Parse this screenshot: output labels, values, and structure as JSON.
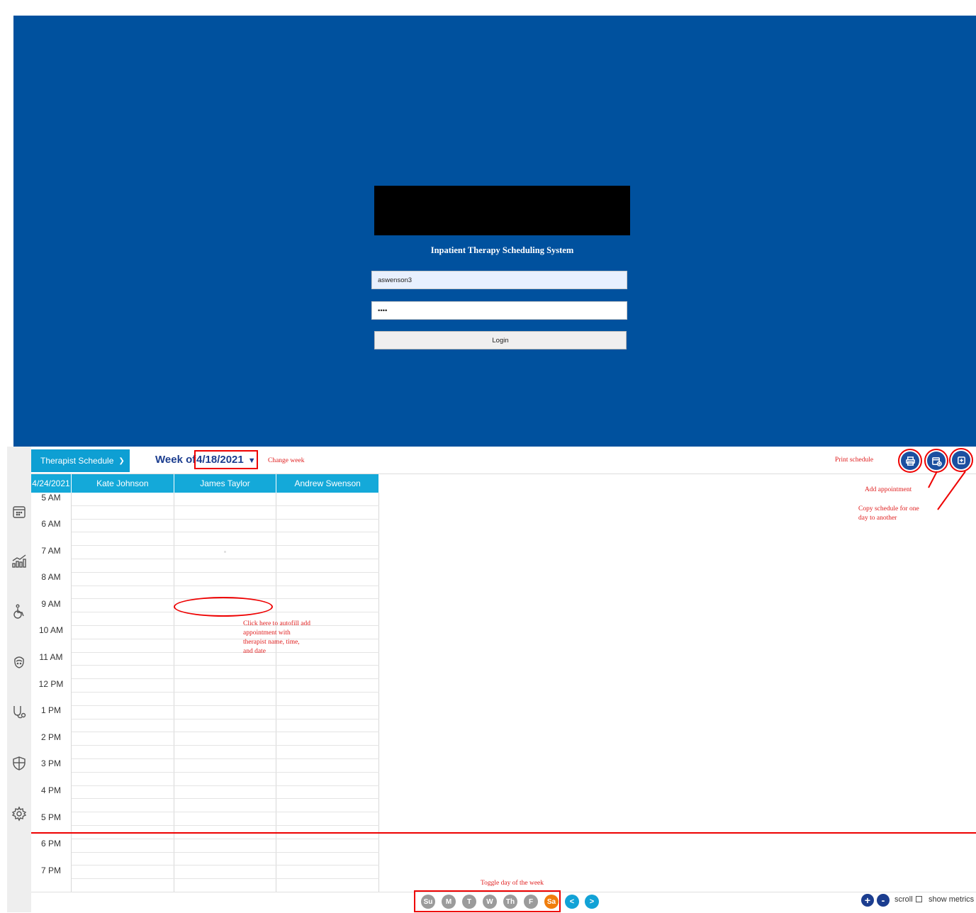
{
  "login": {
    "title": "Inpatient Therapy Scheduling System",
    "username_value": "aswenson3",
    "password_value": "••••",
    "login_label": "Login"
  },
  "schedule": {
    "view_label": "Therapist Schedule",
    "week_prefix": "Week of",
    "week_date": "4/18/2021",
    "date_header": "4/24/2021",
    "therapists": [
      "Kate Johnson",
      "James Taylor",
      "Andrew Swenson"
    ],
    "times": [
      "5 AM",
      "6 AM",
      "7 AM",
      "8 AM",
      "9 AM",
      "10 AM",
      "11 AM",
      "12 PM",
      "1 PM",
      "2 PM",
      "3 PM",
      "4 PM",
      "5 PM",
      "6 PM",
      "7 PM"
    ],
    "days": [
      "Su",
      "M",
      "T",
      "W",
      "Th",
      "F",
      "Sa"
    ],
    "active_day": "Sa",
    "prev_label": "<",
    "next_label": ">",
    "zoom_in_label": "+",
    "zoom_out_label": "-",
    "scroll_label": "scroll",
    "metrics_label": "show metrics"
  },
  "annotations": {
    "change_week": "Change week",
    "print_schedule": "Print schedule",
    "add_appointment": "Add appointment",
    "copy_schedule": "Copy schedule for one\nday to another",
    "click_here": "Click here to autofill add\nappointment with\ntherapist name, time,\nand date",
    "toggle_day": "Toggle day of the week"
  },
  "colors": {
    "login_bg": "#00519e",
    "header_blue": "#14a9d9",
    "dark_blue": "#1b3d8f",
    "annotation_red": "#e02020",
    "active_day": "#f07d0c"
  },
  "rail_icons": [
    "calendar-icon",
    "chart-icon",
    "wheelchair-icon",
    "face-icon",
    "stethoscope-icon",
    "shield-icon",
    "gear-icon"
  ]
}
